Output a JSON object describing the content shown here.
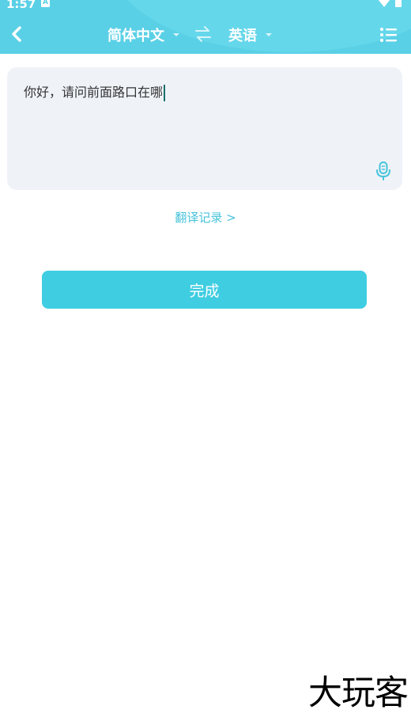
{
  "status_bar": {
    "time": "1:57",
    "notification_icon": "A",
    "icons": [
      "wifi-icon",
      "battery-icon"
    ]
  },
  "header": {
    "back_icon": "chevron-left-icon",
    "source_language": "简体中文",
    "target_language": "英语",
    "swap_icon": "swap-arrows-icon",
    "menu_icon": "list-menu-icon",
    "background_color": "#5ad0e6"
  },
  "input": {
    "value": "你好，请问前面路口在哪",
    "mic_icon": "microphone-icon"
  },
  "history_link": "翻译记录 >",
  "done_button": "完成",
  "watermark": "大玩客",
  "colors": {
    "accent": "#3fcde2",
    "link": "#46c3da",
    "card_background": "#eff3f8"
  }
}
